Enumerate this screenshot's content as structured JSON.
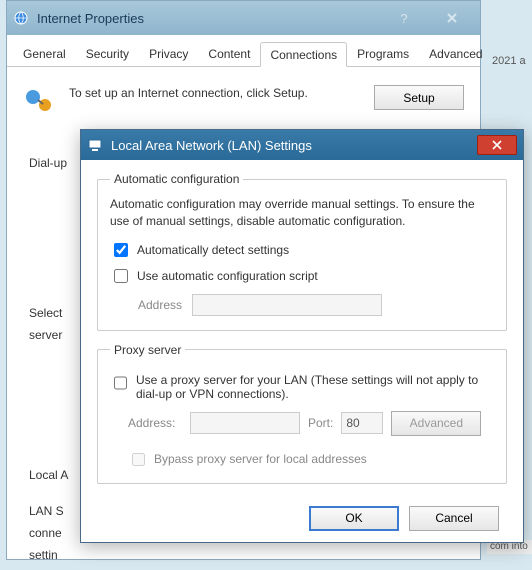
{
  "bg": {
    "year_fragment": "2021 a",
    "bottom_fragment": "com into"
  },
  "parent": {
    "title": "Internet Properties",
    "tabs": [
      "General",
      "Security",
      "Privacy",
      "Content",
      "Connections",
      "Programs",
      "Advanced"
    ],
    "active_tab_index": 4,
    "setup_text": "To set up an Internet connection, click Setup.",
    "setup_button": "Setup",
    "dialup_label": "Dial-up",
    "select_fragment": "Select",
    "server_fragment": "server",
    "local_fragment": "Local A",
    "lan_fragment": "LAN S",
    "conn_fragment": "conne",
    "settin_fragment": "settin"
  },
  "child": {
    "title": "Local Area Network (LAN) Settings",
    "auto": {
      "legend": "Automatic configuration",
      "desc": "Automatic configuration may override manual settings.  To ensure the use of manual settings, disable automatic configuration.",
      "detect_label": "Automatically detect settings",
      "detect_checked": true,
      "script_label": "Use automatic configuration script",
      "script_checked": false,
      "address_label": "Address",
      "address_value": ""
    },
    "proxy": {
      "legend": "Proxy server",
      "use_label": "Use a proxy server for your LAN (These settings will not apply to dial-up or VPN connections).",
      "use_checked": false,
      "address_label": "Address:",
      "address_value": "",
      "port_label": "Port:",
      "port_value": "80",
      "advanced_button": "Advanced",
      "bypass_label": "Bypass proxy server for local addresses",
      "bypass_checked": false
    },
    "ok_button": "OK",
    "cancel_button": "Cancel"
  }
}
